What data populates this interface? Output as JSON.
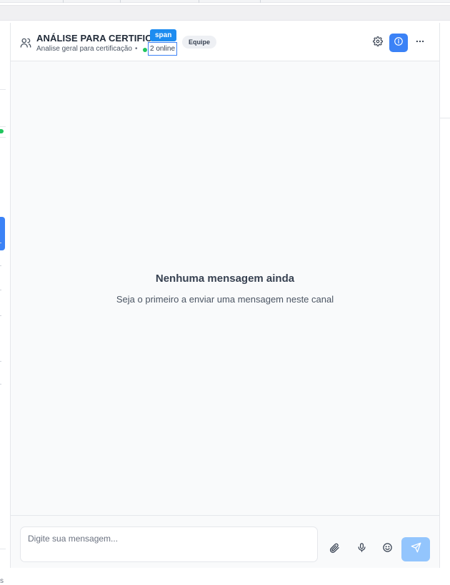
{
  "header": {
    "channel_title": "ANÁLISE PARA CERTIFICAÇÃO",
    "channel_description": "Analise geral para certificação",
    "separator": "•",
    "online_count": "2 online",
    "inspector_tag": "span",
    "badge": "Equipe"
  },
  "empty_state": {
    "title": "Nenhuma mensagem ainda",
    "subtitle": "Seja o primeiro a enviar uma mensagem neste canal"
  },
  "composer": {
    "placeholder": "Digite sua mensagem..."
  },
  "left_edge": {
    "fragment": "s"
  },
  "icons": {
    "channel": "users-icon",
    "settings": "gear-icon",
    "info": "info-icon",
    "more": "more-horizontal-icon",
    "attach": "paperclip-icon",
    "mic": "microphone-icon",
    "emoji": "smile-icon",
    "send": "send-icon"
  },
  "colors": {
    "accent": "#3b82f6",
    "online": "#22c55e",
    "send_disabled": "#93c5fd",
    "inspector_tag": "#1d8cf0"
  }
}
